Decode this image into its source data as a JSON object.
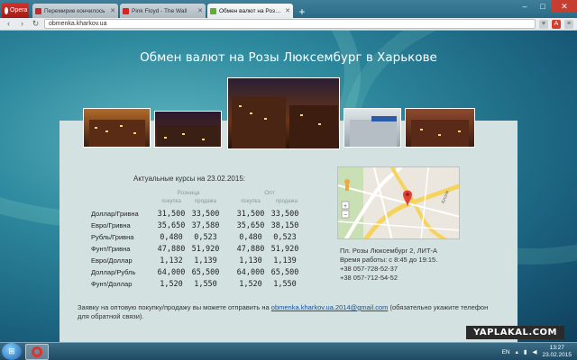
{
  "browser": {
    "menu_label": "Opera",
    "tabs": [
      {
        "label": "Перемирие кончилось",
        "favicon_color": "#c8282a",
        "active": false
      },
      {
        "label": "Pink Floyd - The Wall",
        "favicon_color": "#d92323",
        "active": false
      },
      {
        "label": "Обмен валют на Розы Л",
        "favicon_color": "#5bb02e",
        "active": true
      }
    ],
    "url": "obmenka.kharkov.ua",
    "icons": [
      "opera-icon",
      "tab-close-icon",
      "new-tab-icon",
      "minimize-icon",
      "maximize-icon",
      "close-icon",
      "back-icon",
      "forward-icon",
      "reload-icon",
      "bookmark-icon",
      "adblock-icon",
      "menu-icon"
    ]
  },
  "page": {
    "title": "Обмен валют на Розы Люксембург в Харькове",
    "rates": {
      "heading": "Актуальные курсы на 23.02.2015:",
      "group_retail": "Розница",
      "group_wholesale": "Опт",
      "col_buy": "покупка",
      "col_sell": "продажа",
      "rows": [
        {
          "pair": "Доллар/Гривна",
          "retail_buy": "31,500",
          "retail_sell": "33,500",
          "opt_buy": "31,500",
          "opt_sell": "33,500"
        },
        {
          "pair": "Евро/Гривна",
          "retail_buy": "35,650",
          "retail_sell": "37,580",
          "opt_buy": "35,650",
          "opt_sell": "38,150"
        },
        {
          "pair": "Рубль/Гривна",
          "retail_buy": "0,480",
          "retail_sell": "0,523",
          "opt_buy": "0,480",
          "opt_sell": "0,523"
        },
        {
          "pair": "Фунт/Гривна",
          "retail_buy": "47,880",
          "retail_sell": "51,920",
          "opt_buy": "47,880",
          "opt_sell": "51,920"
        },
        {
          "pair": "Евро/Доллар",
          "retail_buy": "1,132",
          "retail_sell": "1,139",
          "opt_buy": "1,130",
          "opt_sell": "1,139"
        },
        {
          "pair": "Доллар/Рубль",
          "retail_buy": "64,000",
          "retail_sell": "65,500",
          "opt_buy": "64,000",
          "opt_sell": "65,500"
        },
        {
          "pair": "Фунт/Доллар",
          "retail_buy": "1,520",
          "retail_sell": "1,550",
          "opt_buy": "1,520",
          "opt_sell": "1,550"
        }
      ]
    },
    "address": {
      "line1": "Пл. Розы Люксембург 2, ЛИТ-А",
      "hours": "Время работы: с 8:45 до 19:15.",
      "phone1": "+38 057-728-52-37",
      "phone2": "+38 057-712-54-52"
    },
    "map_street_label": "Клочк",
    "note_before": "Заявку на оптовую покупку/продажу вы можете отправить на ",
    "note_email": "obmenka.kharkov.ua.2014@gmail.com",
    "note_after": " (обязательно укажите телефон для обратной связи)."
  },
  "watermark": "YAPLAKAL.COM",
  "taskbar": {
    "lang": "EN",
    "time": "13:27",
    "date": "23.02.2015"
  }
}
